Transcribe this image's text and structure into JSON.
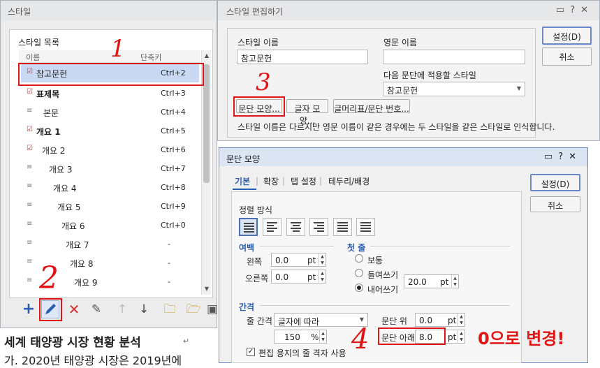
{
  "style_window": {
    "title": "스타일",
    "list_label": "스타일 목록",
    "col_name": "이름",
    "col_shortcut": "단축키",
    "items": [
      {
        "name": "참고문헌",
        "shortcut": "Ctrl+2"
      },
      {
        "name": "표제목",
        "shortcut": "Ctrl+3"
      },
      {
        "name": "본문",
        "shortcut": "Ctrl+4"
      },
      {
        "name": "개요 1",
        "shortcut": "Ctrl+5"
      },
      {
        "name": "개요 2",
        "shortcut": "Ctrl+6"
      },
      {
        "name": "개요 3",
        "shortcut": "Ctrl+7"
      },
      {
        "name": "개요 4",
        "shortcut": "Ctrl+8"
      },
      {
        "name": "개요 5",
        "shortcut": "Ctrl+9"
      },
      {
        "name": "개요 6",
        "shortcut": "Ctrl+0"
      },
      {
        "name": "개요 7",
        "shortcut": "-"
      },
      {
        "name": "개요 8",
        "shortcut": "-"
      },
      {
        "name": "개요 9",
        "shortcut": "-"
      }
    ]
  },
  "doc": {
    "heading": "세계 태양광 시장 현황 분석",
    "line2": "가. 2020년 태양광 시장은 2019년에"
  },
  "edit_dialog": {
    "title": "스타일 편집하기",
    "style_name_label": "스타일 이름",
    "style_name_value": "참고문헌",
    "english_name_label": "영문 이름",
    "english_name_value": "",
    "next_style_label": "다음 문단에 적용할 스타일",
    "next_style_value": "참고문헌",
    "btn_para": "문단 모양...",
    "btn_char": "글자 모양...",
    "btn_bullet": "글머리표/문단 번호...",
    "info": "스타일 이름은 다르지만 영문 이름이 같은 경우에는 두 스타일을 같은 스타일로 인식합니다.",
    "ok": "설정(D)",
    "cancel": "취소"
  },
  "para_dialog": {
    "title": "문단 모양",
    "tabs": [
      "기본",
      "확장",
      "탭 설정",
      "테두리/배경"
    ],
    "align_label": "정렬 방식",
    "margin_label": "여백",
    "left_label": "왼쪽",
    "left_value": "0.0",
    "right_label": "오른쪽",
    "right_value": "0.0",
    "unit_pt": "pt",
    "first_line_label": "첫 줄",
    "opt_normal": "보통",
    "opt_indent": "들여쓰기",
    "opt_outdent": "내어쓰기",
    "outdent_value": "20.0",
    "spacing_label": "간격",
    "line_spacing_label": "줄 간격",
    "line_spacing_mode": "글자에 따라",
    "line_spacing_value": "150",
    "unit_pct": "%",
    "above_label": "문단 위",
    "above_value": "0.0",
    "below_label": "문단 아래",
    "below_value": "8.0",
    "grid_checkbox": "편집 용지의 줄 격자 사용",
    "ok": "설정(D)",
    "cancel": "취소"
  },
  "annotations": {
    "n1": "1",
    "n2": "2",
    "n3": "3",
    "n4": "4",
    "note": "0으로 변경!"
  },
  "colors": {
    "accent": "#e01515",
    "selection": "#c9d9f3",
    "blue": "#2a5db0"
  }
}
